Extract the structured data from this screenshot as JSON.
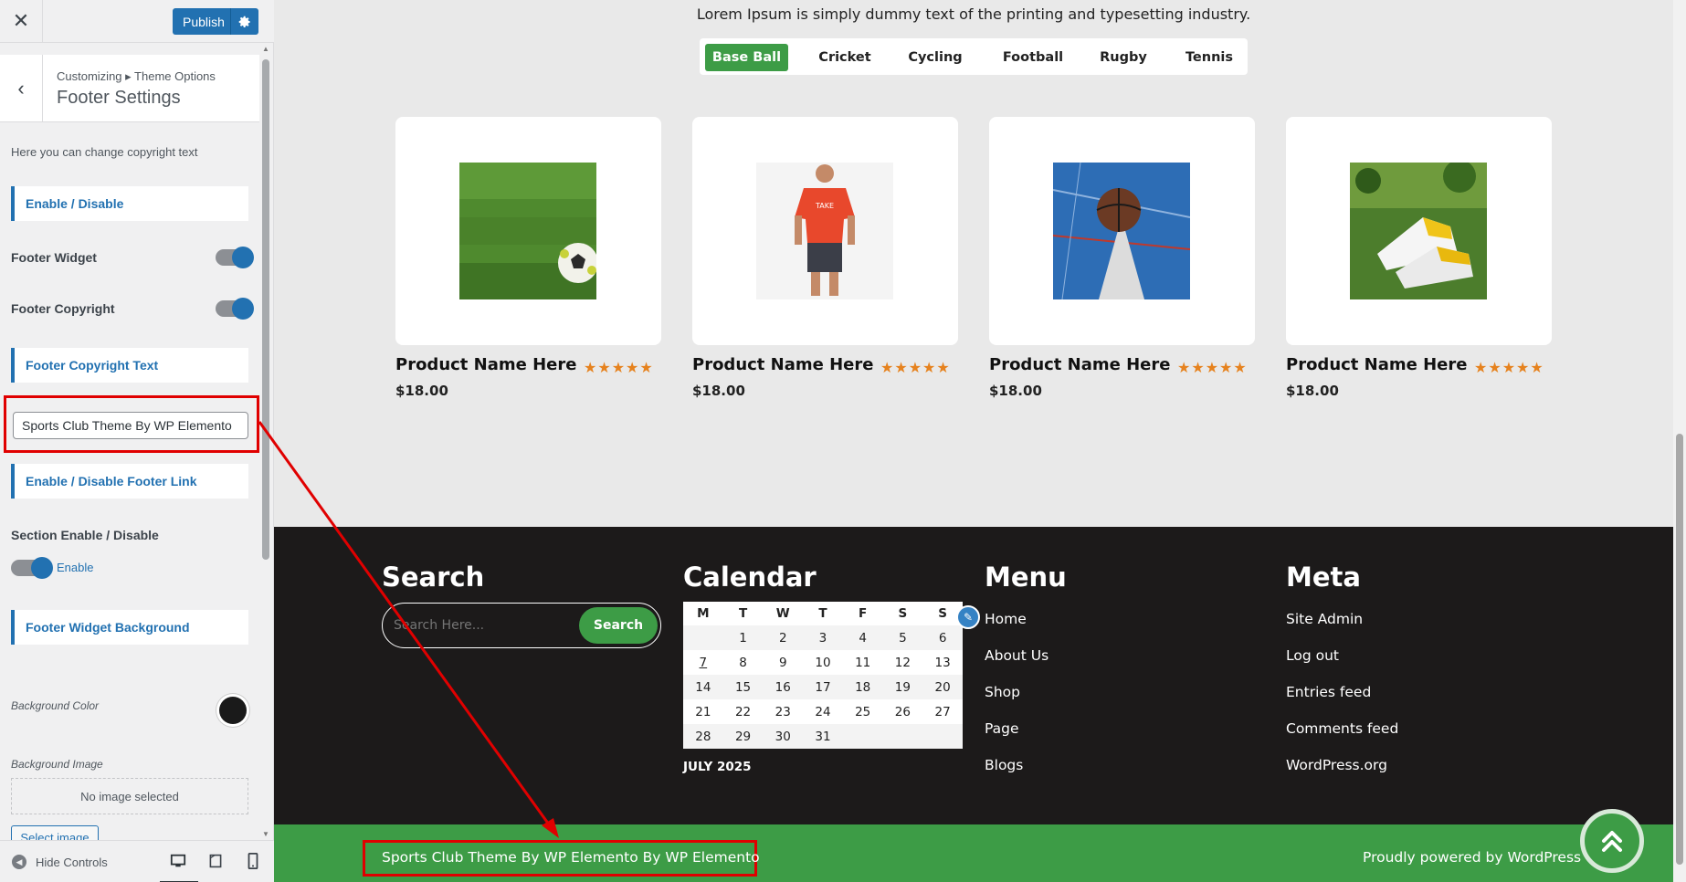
{
  "customizer": {
    "close_icon": "close-icon",
    "publish_label": "Publish",
    "breadcrumb": "Customizing ▸ Theme Options",
    "section_title": "Footer Settings",
    "description": "Here you can change copyright text",
    "enable_disable": "Enable / Disable",
    "footer_widget_label": "Footer Widget",
    "footer_copyright_label": "Footer Copyright",
    "footer_copyright_text_label": "Footer Copyright Text",
    "copyright_input_value": "Sports Club Theme By WP Elemento",
    "footer_link_label": "Enable / Disable Footer Link",
    "section_enable_label": "Section Enable / Disable",
    "enable_text": "Enable",
    "widget_bg_label": "Footer Widget Background",
    "bg_color_label": "Background Color",
    "bg_color_value": "#1a1a1a",
    "bg_image_label": "Background Image",
    "no_image": "No image selected",
    "select_image": "Select image",
    "hide_controls": "Hide Controls"
  },
  "preview": {
    "intro": "Lorem Ipsum is simply dummy text of the printing and typesetting industry.",
    "tabs": [
      "Base Ball",
      "Cricket",
      "Cycling",
      "Football",
      "Rugby",
      "Tennis"
    ],
    "active_tab": "Base Ball",
    "products": [
      {
        "name": "Product Name Here",
        "price": "$18.00",
        "stars": "★★★★★",
        "image": "soccer-ball-on-grass"
      },
      {
        "name": "Product Name Here",
        "price": "$18.00",
        "stars": "★★★★★",
        "image": "man-in-red-shirt"
      },
      {
        "name": "Product Name Here",
        "price": "$18.00",
        "stars": "★★★★★",
        "image": "basketball-on-court"
      },
      {
        "name": "Product Name Here",
        "price": "$18.00",
        "stars": "★★★★★",
        "image": "football-boots-on-grass"
      }
    ],
    "footer": {
      "search_heading": "Search",
      "search_placeholder": "Search Here...",
      "search_button": "Search",
      "calendar_heading": "Calendar",
      "calendar_days": [
        "M",
        "T",
        "W",
        "T",
        "F",
        "S",
        "S"
      ],
      "calendar_rows": [
        [
          "",
          "1",
          "2",
          "3",
          "4",
          "5",
          "6"
        ],
        [
          "7",
          "8",
          "9",
          "10",
          "11",
          "12",
          "13"
        ],
        [
          "14",
          "15",
          "16",
          "17",
          "18",
          "19",
          "20"
        ],
        [
          "21",
          "22",
          "23",
          "24",
          "25",
          "26",
          "27"
        ],
        [
          "28",
          "29",
          "30",
          "31",
          "",
          "",
          ""
        ]
      ],
      "calendar_caption": "JULY 2025",
      "menu_heading": "Menu",
      "menu_links": [
        "Home",
        "About Us",
        "Shop",
        "Page",
        "Blogs"
      ],
      "meta_heading": "Meta",
      "meta_links": [
        "Site Admin",
        "Log out",
        "Entries feed",
        "Comments feed",
        "WordPress.org"
      ]
    },
    "copyright": "Sports Club Theme By WP Elemento By WP Elemento",
    "powered_by": "Proudly powered by WordPress"
  },
  "colors": {
    "wp_blue": "#2271b1",
    "accent_green": "#3d9c46",
    "star_orange": "#e6821e",
    "footer_dark": "#1c1a1a",
    "highlight_red": "#e00000"
  }
}
